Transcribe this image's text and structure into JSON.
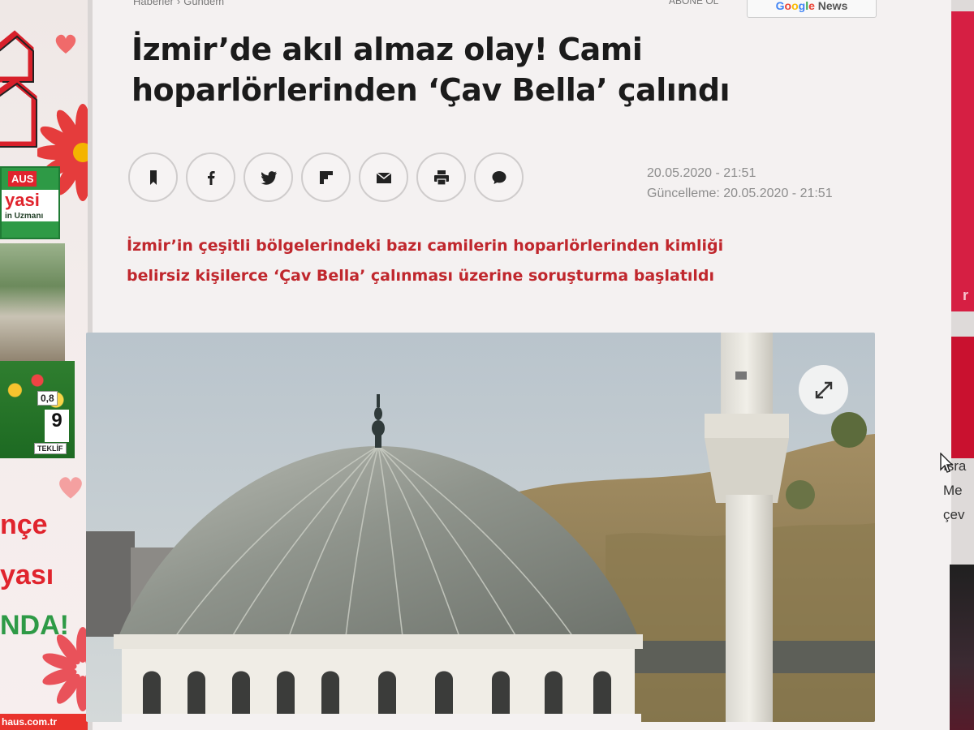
{
  "left_ad": {
    "brand_top": "AUS",
    "headline_1": "yasi",
    "tagline": "in Uzmanı",
    "price_1": "0,8",
    "price_2": "9",
    "price_caption": "TEKLİF",
    "big_text_1": "nçe",
    "big_text_2": "yası",
    "big_text_3": "NDA!",
    "url": "haus.com.tr",
    "colors": {
      "red": "#e0242d",
      "green": "#2e9a46"
    }
  },
  "article": {
    "breadcrumb": [
      "Haberler",
      "Gündem"
    ],
    "breadcrumb_separator": "›",
    "subscribe": "ABONE OL",
    "google_news": {
      "g": "G",
      "o1": "o",
      "o2": "o",
      "g2": "g",
      "l": "l",
      "e": "e",
      "news": "News"
    },
    "headline_line1": "İzmir’de akıl almaz olay! Cami",
    "headline_line2": "hoparlörlerinden ‘Çav Bella’ çalındı",
    "share_buttons": [
      {
        "name": "bookmark-icon"
      },
      {
        "name": "facebook-icon"
      },
      {
        "name": "twitter-icon"
      },
      {
        "name": "flipboard-icon"
      },
      {
        "name": "email-icon"
      },
      {
        "name": "print-icon"
      },
      {
        "name": "comment-icon"
      }
    ],
    "published": "20.05.2020 - 21:51",
    "updated": "Güncelleme: 20.05.2020 - 21:51",
    "spot_line1": "İzmir’in çeşitli bölgelerindeki bazı camilerin hoparlörlerinden kimliği",
    "spot_line2": "belirsiz kişilerce ‘Çav Bella’ çalınması üzerine soruşturma başlatıldı",
    "accent_color": "#c0272d",
    "image_expand_icon": "expand-icon"
  },
  "sidebar": {
    "block1_text": "r",
    "teaser_line1": "Isra",
    "teaser_line2": "Me",
    "teaser_line3": "çev"
  }
}
